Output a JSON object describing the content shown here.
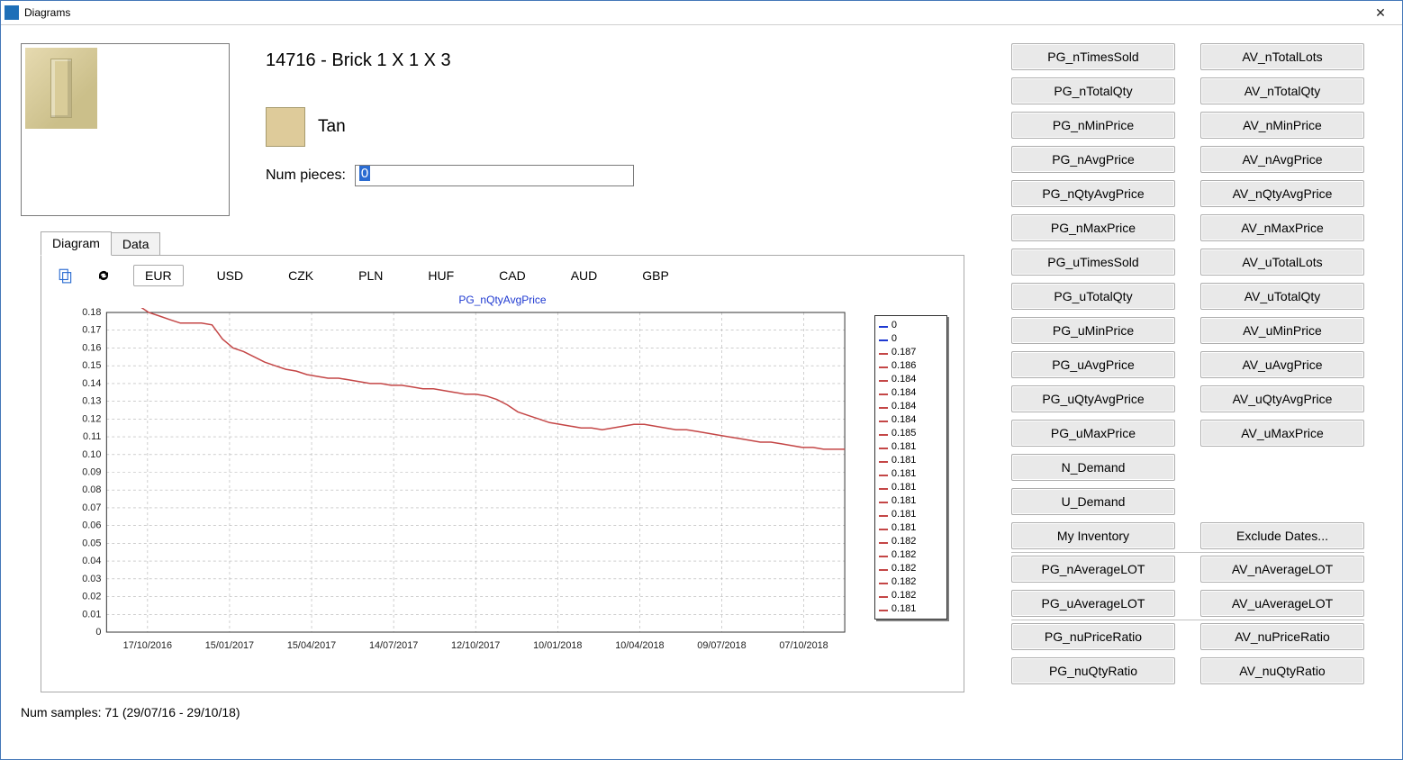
{
  "window": {
    "title": "Diagrams"
  },
  "item": {
    "title": "14716 - Brick 1 X 1 X 3",
    "color_name": "Tan",
    "num_pieces_label": "Num pieces:",
    "num_pieces_value": "0"
  },
  "buttons": {
    "groups": [
      {
        "left": "PG_nTimesSold",
        "right": "AV_nTotalLots"
      },
      {
        "left": "PG_nTotalQty",
        "right": "AV_nTotalQty"
      },
      {
        "left": "PG_nMinPrice",
        "right": "AV_nMinPrice"
      },
      {
        "left": "PG_nAvgPrice",
        "right": "AV_nAvgPrice"
      },
      {
        "left": "PG_nQtyAvgPrice",
        "right": "AV_nQtyAvgPrice"
      },
      {
        "left": "PG_nMaxPrice",
        "right": "AV_nMaxPrice"
      },
      {
        "left": "PG_uTimesSold",
        "right": "AV_uTotalLots"
      },
      {
        "left": "PG_uTotalQty",
        "right": "AV_uTotalQty"
      },
      {
        "left": "PG_uMinPrice",
        "right": "AV_uMinPrice"
      },
      {
        "left": "PG_uAvgPrice",
        "right": "AV_uAvgPrice"
      },
      {
        "left": "PG_uQtyAvgPrice",
        "right": "AV_uQtyAvgPrice"
      },
      {
        "left": "PG_uMaxPrice",
        "right": "AV_uMaxPrice"
      },
      {
        "left": "N_Demand",
        "right": ""
      },
      {
        "left": "U_Demand",
        "right": ""
      },
      {
        "left": "My Inventory",
        "right": "Exclude Dates..."
      }
    ],
    "groups2": [
      {
        "left": "PG_nAverageLOT",
        "right": "AV_nAverageLOT"
      },
      {
        "left": "PG_uAverageLOT",
        "right": "AV_uAverageLOT"
      }
    ],
    "groups3": [
      {
        "left": "PG_nuPriceRatio",
        "right": "AV_nuPriceRatio"
      },
      {
        "left": "PG_nuQtyRatio",
        "right": "AV_nuQtyRatio"
      }
    ]
  },
  "tabs": {
    "diagram": "Diagram",
    "data": "Data"
  },
  "toolbar": {
    "currencies": [
      "EUR",
      "USD",
      "CZK",
      "PLN",
      "HUF",
      "CAD",
      "AUD",
      "GBP"
    ],
    "active_currency": "EUR"
  },
  "chart_data": {
    "type": "line",
    "title": "PG_nQtyAvgPrice",
    "xlabel": "",
    "ylabel": "",
    "ylim": [
      0,
      0.18
    ],
    "y_ticks": [
      0,
      0.01,
      0.02,
      0.03,
      0.04,
      0.05,
      0.06,
      0.07,
      0.08,
      0.09,
      0.1,
      0.11,
      0.12,
      0.13,
      0.14,
      0.15,
      0.16,
      0.17,
      0.18
    ],
    "x_tick_labels": [
      "17/10/2016",
      "15/01/2017",
      "15/04/2017",
      "14/07/2017",
      "12/10/2017",
      "10/01/2018",
      "10/04/2018",
      "09/07/2018",
      "07/10/2018"
    ],
    "series": [
      {
        "name": "PG_nQtyAvgPrice",
        "values": [
          0.187,
          0.186,
          0.184,
          0.184,
          0.18,
          0.178,
          0.176,
          0.174,
          0.174,
          0.174,
          0.173,
          0.165,
          0.16,
          0.158,
          0.155,
          0.152,
          0.15,
          0.148,
          0.147,
          0.145,
          0.144,
          0.143,
          0.143,
          0.142,
          0.141,
          0.14,
          0.14,
          0.139,
          0.139,
          0.138,
          0.137,
          0.137,
          0.136,
          0.135,
          0.134,
          0.134,
          0.133,
          0.131,
          0.128,
          0.124,
          0.122,
          0.12,
          0.118,
          0.117,
          0.116,
          0.115,
          0.115,
          0.114,
          0.115,
          0.116,
          0.117,
          0.117,
          0.116,
          0.115,
          0.114,
          0.114,
          0.113,
          0.112,
          0.111,
          0.11,
          0.109,
          0.108,
          0.107,
          0.107,
          0.106,
          0.105,
          0.104,
          0.104,
          0.103,
          0.103,
          0.103
        ]
      }
    ]
  },
  "legend_values": [
    "0",
    "0",
    "0.187",
    "0.186",
    "0.184",
    "0.184",
    "0.184",
    "0.184",
    "0.185",
    "0.181",
    "0.181",
    "0.181",
    "0.181",
    "0.181",
    "0.181",
    "0.181",
    "0.182",
    "0.182",
    "0.182",
    "0.182",
    "0.182",
    "0.181"
  ],
  "status": "Num samples: 71 (29/07/16 - 29/10/18)"
}
